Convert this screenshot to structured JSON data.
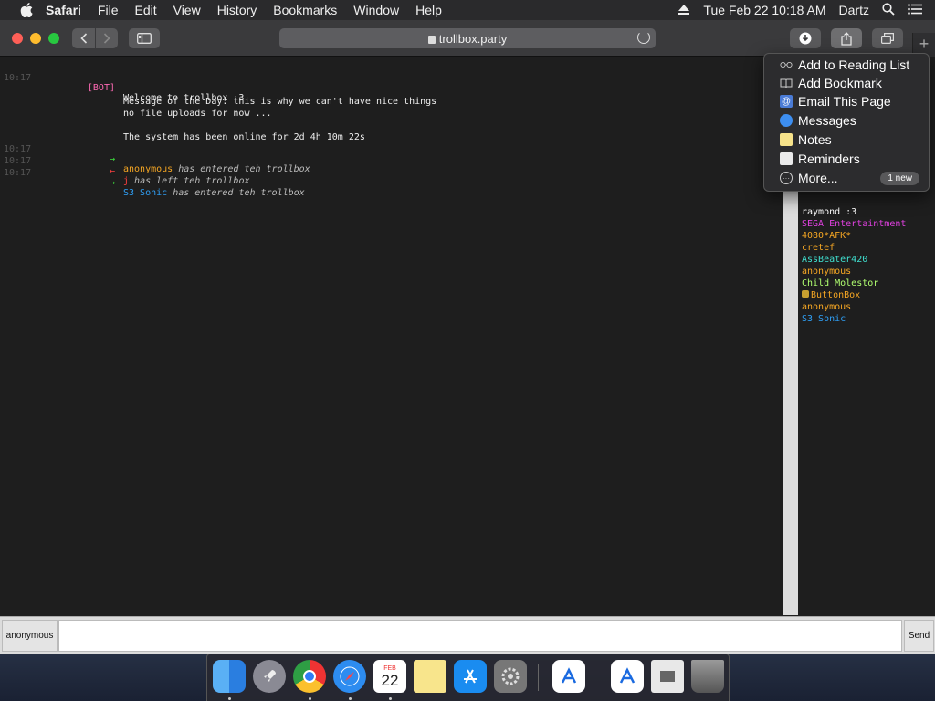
{
  "menubar": {
    "app": "Safari",
    "items": [
      "File",
      "Edit",
      "View",
      "History",
      "Bookmarks",
      "Window",
      "Help"
    ],
    "datetime": "Tue Feb 22  10:18 AM",
    "user": "Dartz"
  },
  "toolbar": {
    "url": "trollbox.party"
  },
  "chat": {
    "lines": [
      {
        "ts": "",
        "nick": "[BOT]",
        "msg": "Welcome to trollbox :3"
      },
      {
        "msg": "Message of the Day: this is why we can't have nice things"
      },
      {
        "msg": "no file uploads for now ..."
      },
      {
        "msg": "The system has been online for 2d 4h 10m 22s"
      },
      {
        "ts": "10:17",
        "arrow": "→",
        "who": "anonymous",
        "action": " has entered teh trollbox"
      },
      {
        "ts": "10:17",
        "arrow": "←",
        "who": "j",
        "action": " has left teh trollbox"
      },
      {
        "ts": "10:17",
        "arrow": "→",
        "who": "S3 Sonic",
        "action": " has entered teh trollbox"
      }
    ],
    "first_ts": "10:17"
  },
  "users": [
    {
      "name": "raymond :3",
      "color": "#ffffff"
    },
    {
      "name": "SEGA Entertaintment",
      "color": "#e040e0"
    },
    {
      "name": "4080*AFK*",
      "color": "#f5a623"
    },
    {
      "name": "cretef",
      "color": "#f5a623"
    },
    {
      "name": "AssBeater420",
      "color": "#40e0d0"
    },
    {
      "name": "anonymous",
      "color": "#f5a623"
    },
    {
      "name": "Child Molestor",
      "color": "#b0ff70"
    },
    {
      "name": "ButtonBox",
      "color": "#f5a623"
    },
    {
      "name": "anonymous",
      "color": "#f5a623"
    },
    {
      "name": "S3 Sonic",
      "color": "#2f9ff5"
    }
  ],
  "share_menu": {
    "items": [
      "Add to Reading List",
      "Add Bookmark",
      "Email This Page",
      "Messages",
      "Notes",
      "Reminders",
      "More..."
    ],
    "badge": "1 new"
  },
  "input": {
    "nick": "anonymous",
    "send": "Send"
  },
  "dock": {
    "items": [
      "Finder",
      "Launchpad",
      "Chrome",
      "Safari",
      "Calendar",
      "Notes",
      "App Store",
      "System Preferences",
      "Xcode",
      "Xcode",
      "Preview",
      "Trash"
    ],
    "calendar_month": "FEB",
    "calendar_day": "22"
  }
}
